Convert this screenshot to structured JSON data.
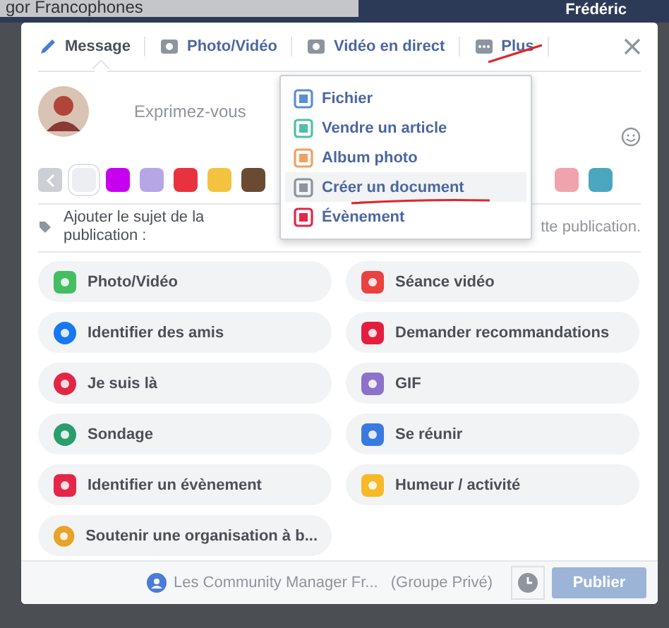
{
  "backdrop": {
    "search_text": "gor Francophones",
    "user_name": "Frédéric"
  },
  "tabs": [
    {
      "label": "Message",
      "selected": true
    },
    {
      "label": "Photo/Vidéo",
      "selected": false
    },
    {
      "label": "Vidéo en direct",
      "selected": false
    },
    {
      "label": "Plus",
      "selected": false
    }
  ],
  "composer": {
    "placeholder": "Exprimez-vous"
  },
  "swatches": [
    {
      "color": "#eceef2",
      "selected": true
    },
    {
      "color": "#c800f0",
      "selected": false
    },
    {
      "color": "#b7a6e6",
      "selected": false
    },
    {
      "color": "#e8323f",
      "selected": false
    },
    {
      "color": "#f3c340",
      "selected": false
    },
    {
      "color": "#6b4a32",
      "selected": false
    },
    {
      "color": "#f0a3ac",
      "selected": false
    },
    {
      "color": "#4aa7bf",
      "selected": false
    }
  ],
  "topic": {
    "label": "Ajouter le sujet de la publication :",
    "hint": "tte publication."
  },
  "menu": [
    {
      "label": "Fichier",
      "selected": false
    },
    {
      "label": "Vendre un article",
      "selected": false
    },
    {
      "label": "Album photo",
      "selected": false
    },
    {
      "label": "Créer un document",
      "selected": true
    },
    {
      "label": "Évènement",
      "selected": false
    }
  ],
  "actions": [
    {
      "label": "Photo/Vidéo"
    },
    {
      "label": "Séance vidéo"
    },
    {
      "label": "Identifier des amis"
    },
    {
      "label": "Demander recommandations"
    },
    {
      "label": "Je suis là"
    },
    {
      "label": "GIF"
    },
    {
      "label": "Sondage"
    },
    {
      "label": "Se réunir"
    },
    {
      "label": "Identifier un évènement"
    },
    {
      "label": "Humeur / activité"
    },
    {
      "label": "Soutenir une organisation à b..."
    }
  ],
  "footer": {
    "audience": "Les Community Manager Fr...",
    "group_type": "(Groupe Privé)",
    "publish": "Publier"
  }
}
